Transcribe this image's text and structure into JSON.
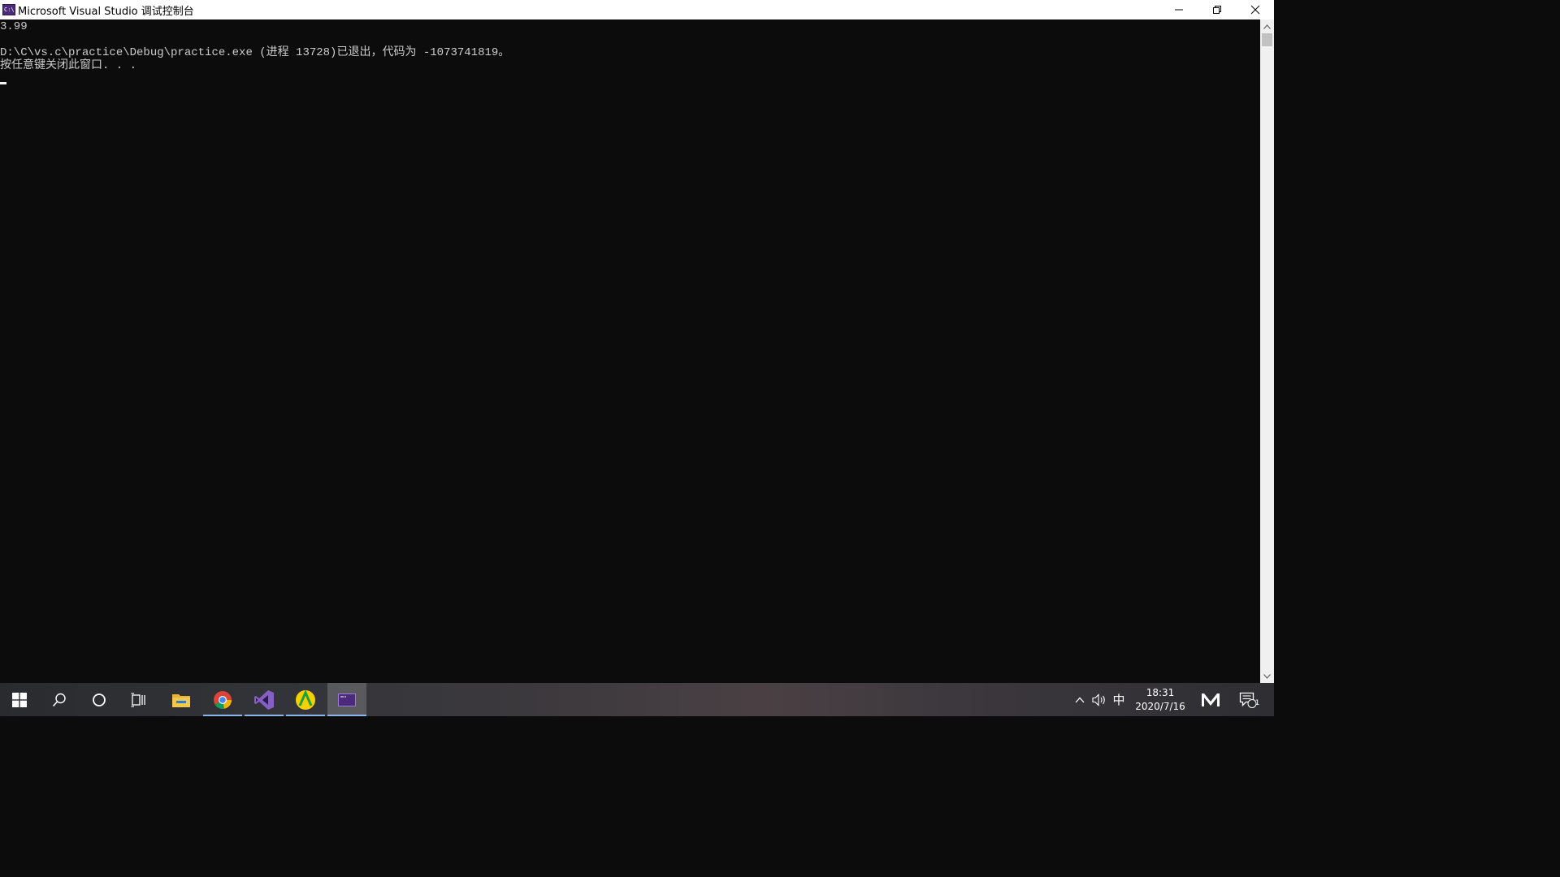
{
  "window": {
    "title": "Microsoft Visual Studio 调试控制台"
  },
  "console": {
    "lines": [
      "3.99",
      "",
      "D:\\C\\vs.c\\practice\\Debug\\practice.exe (进程 13728)已退出，代码为 -1073741819。",
      "按任意键关闭此窗口. . ."
    ]
  },
  "tray": {
    "ime": "中",
    "time": "18:31",
    "date": "2020/7/16",
    "notification_count": "1"
  },
  "colors": {
    "console_bg": "#0c0c0c",
    "console_fg": "#cccccc",
    "active_indicator": "#8ab4e8"
  }
}
